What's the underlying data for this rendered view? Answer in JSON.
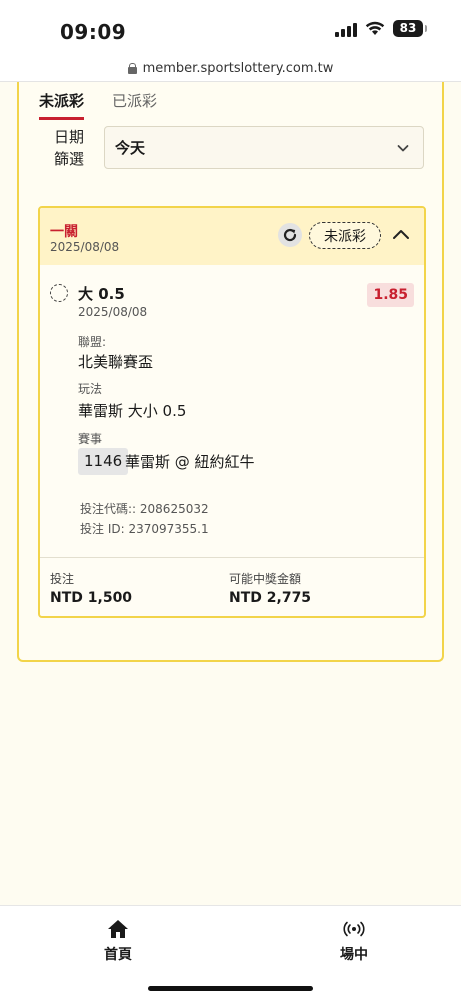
{
  "status_bar": {
    "time": "09:09",
    "battery": "83"
  },
  "browser": {
    "url": "member.sportslottery.com.tw"
  },
  "tabs": [
    {
      "label": "未派彩",
      "active": true
    },
    {
      "label": "已派彩",
      "active": false
    }
  ],
  "filter": {
    "label_line1": "日期",
    "label_line2": "篩選",
    "selected": "今天"
  },
  "bet_card": {
    "bet_type": "一關",
    "date": "2025/08/08",
    "status": "未派彩",
    "selection": {
      "name": "大 0.5",
      "date": "2025/08/08",
      "odds": "1.85"
    },
    "league_label": "聯盟:",
    "league_value": "北美聯賽盃",
    "market_label": "玩法",
    "market_value": "華雷斯 大小 0.5",
    "event_label": "賽事",
    "event_id": "1146",
    "event_name": "華雷斯 @ 紐約紅牛",
    "bet_code": "投注代碼:: 208625032",
    "bet_id": "投注 ID: 237097355.1",
    "stake_label": "投注",
    "stake_value": "NTD 1,500",
    "payout_label": "可能中獎金額",
    "payout_value": "NTD 2,775"
  },
  "bottom_nav": [
    {
      "label": "首頁",
      "icon": "home-icon"
    },
    {
      "label": "場中",
      "icon": "live-broadcast-icon"
    }
  ],
  "colors": {
    "accent_red": "#c8202f",
    "card_border": "#f2d44a",
    "header_bg": "#fff3c7"
  }
}
